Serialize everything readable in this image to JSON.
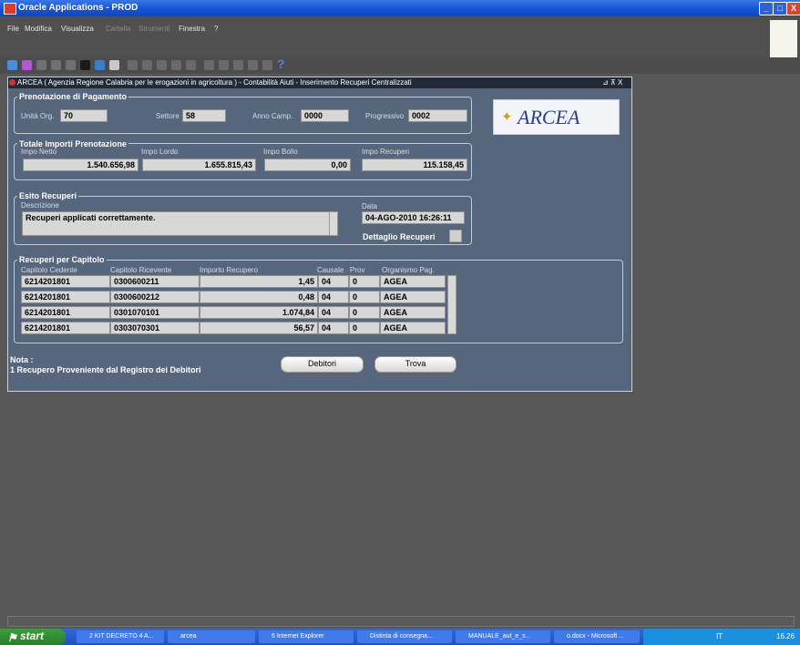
{
  "window": {
    "title": "Oracle Applications - PROD",
    "min": "_",
    "max": "□",
    "close": "X"
  },
  "menu": [
    "File",
    "Modifica",
    "Visualizza",
    "Cartella",
    "Strumenti",
    "Finestra",
    "?"
  ],
  "form": {
    "title": "ARCEA  ( Agenzia Regione Calabria per le erogazioni in agricoltura ) - Contabilità  Aiuti - Inserimento Recuperi Centralizzati",
    "ctrl": "⊿ ⊼ X",
    "logo": "ARCEA",
    "prenotazione": {
      "title": "Prenotazione di Pagamento",
      "unita_label": "Unità Org.",
      "unita_value": "70",
      "settore_label": "Settore",
      "settore_value": "58",
      "anno_label": "Anno Camp.",
      "anno_value": "0000",
      "progressivo_label": "Progressivo",
      "progressivo_value": "0002"
    },
    "totale": {
      "title": "Totale Importi Prenotazione",
      "netto_label": "Impo Netto",
      "netto_value": "1.540.656,98",
      "lordo_label": "Impo Lordo",
      "lordo_value": "1.655.815,43",
      "bollo_label": "Impo Bollo",
      "bollo_value": "0,00",
      "recuperi_label": "Impo Recuperi",
      "recuperi_value": "115.158,45"
    },
    "esito": {
      "title": "Esito Recuperi",
      "descr_label": "Descrizione",
      "descr_value": "Recuperi applicati correttamente.",
      "data_label": "Data",
      "data_value": "04-AGO-2010 16:26:11",
      "dettaglio_label": "Dettaglio Recuperi"
    },
    "capitolo": {
      "title": "Recuperi per Capitolo",
      "headers": [
        "Capitolo Cedente",
        "Capitolo Ricevente",
        "Importo Recupero",
        "Causale",
        "Prov",
        "Organismo Pag."
      ],
      "rows": [
        {
          "ced": "6214201801",
          "ric": "0300600211",
          "imp": "1,45",
          "cau": "04",
          "prov": "0",
          "org": "AGEA"
        },
        {
          "ced": "6214201801",
          "ric": "0300600212",
          "imp": "0,48",
          "cau": "04",
          "prov": "0",
          "org": "AGEA"
        },
        {
          "ced": "6214201801",
          "ric": "0301070101",
          "imp": "1.074,84",
          "cau": "04",
          "prov": "0",
          "org": "AGEA"
        },
        {
          "ced": "6214201801",
          "ric": "0303070301",
          "imp": "56,57",
          "cau": "04",
          "prov": "0",
          "org": "AGEA"
        }
      ]
    },
    "nota_label": "Nota :",
    "nota_text": "1  Recupero Proveniente dal Registro dei Debitori",
    "debitori_button": "Debitori",
    "trova_button": "Trova"
  },
  "taskbar": {
    "start": "start",
    "items": [
      "2 KIT DECRETO 4 A...",
      "arcea",
      "6 Internet Explorer",
      "Distinta di consegna...",
      "MANUALE_aut_e_s...",
      "o.docx - Microsoft ..."
    ],
    "lang": "IT",
    "clock": "16.26"
  },
  "colors": {
    "title_blue": "#1655d6",
    "form_bg": "#56667d",
    "taskbar_blue": "#1f4fc4",
    "start_green": "#2a7e2a"
  }
}
